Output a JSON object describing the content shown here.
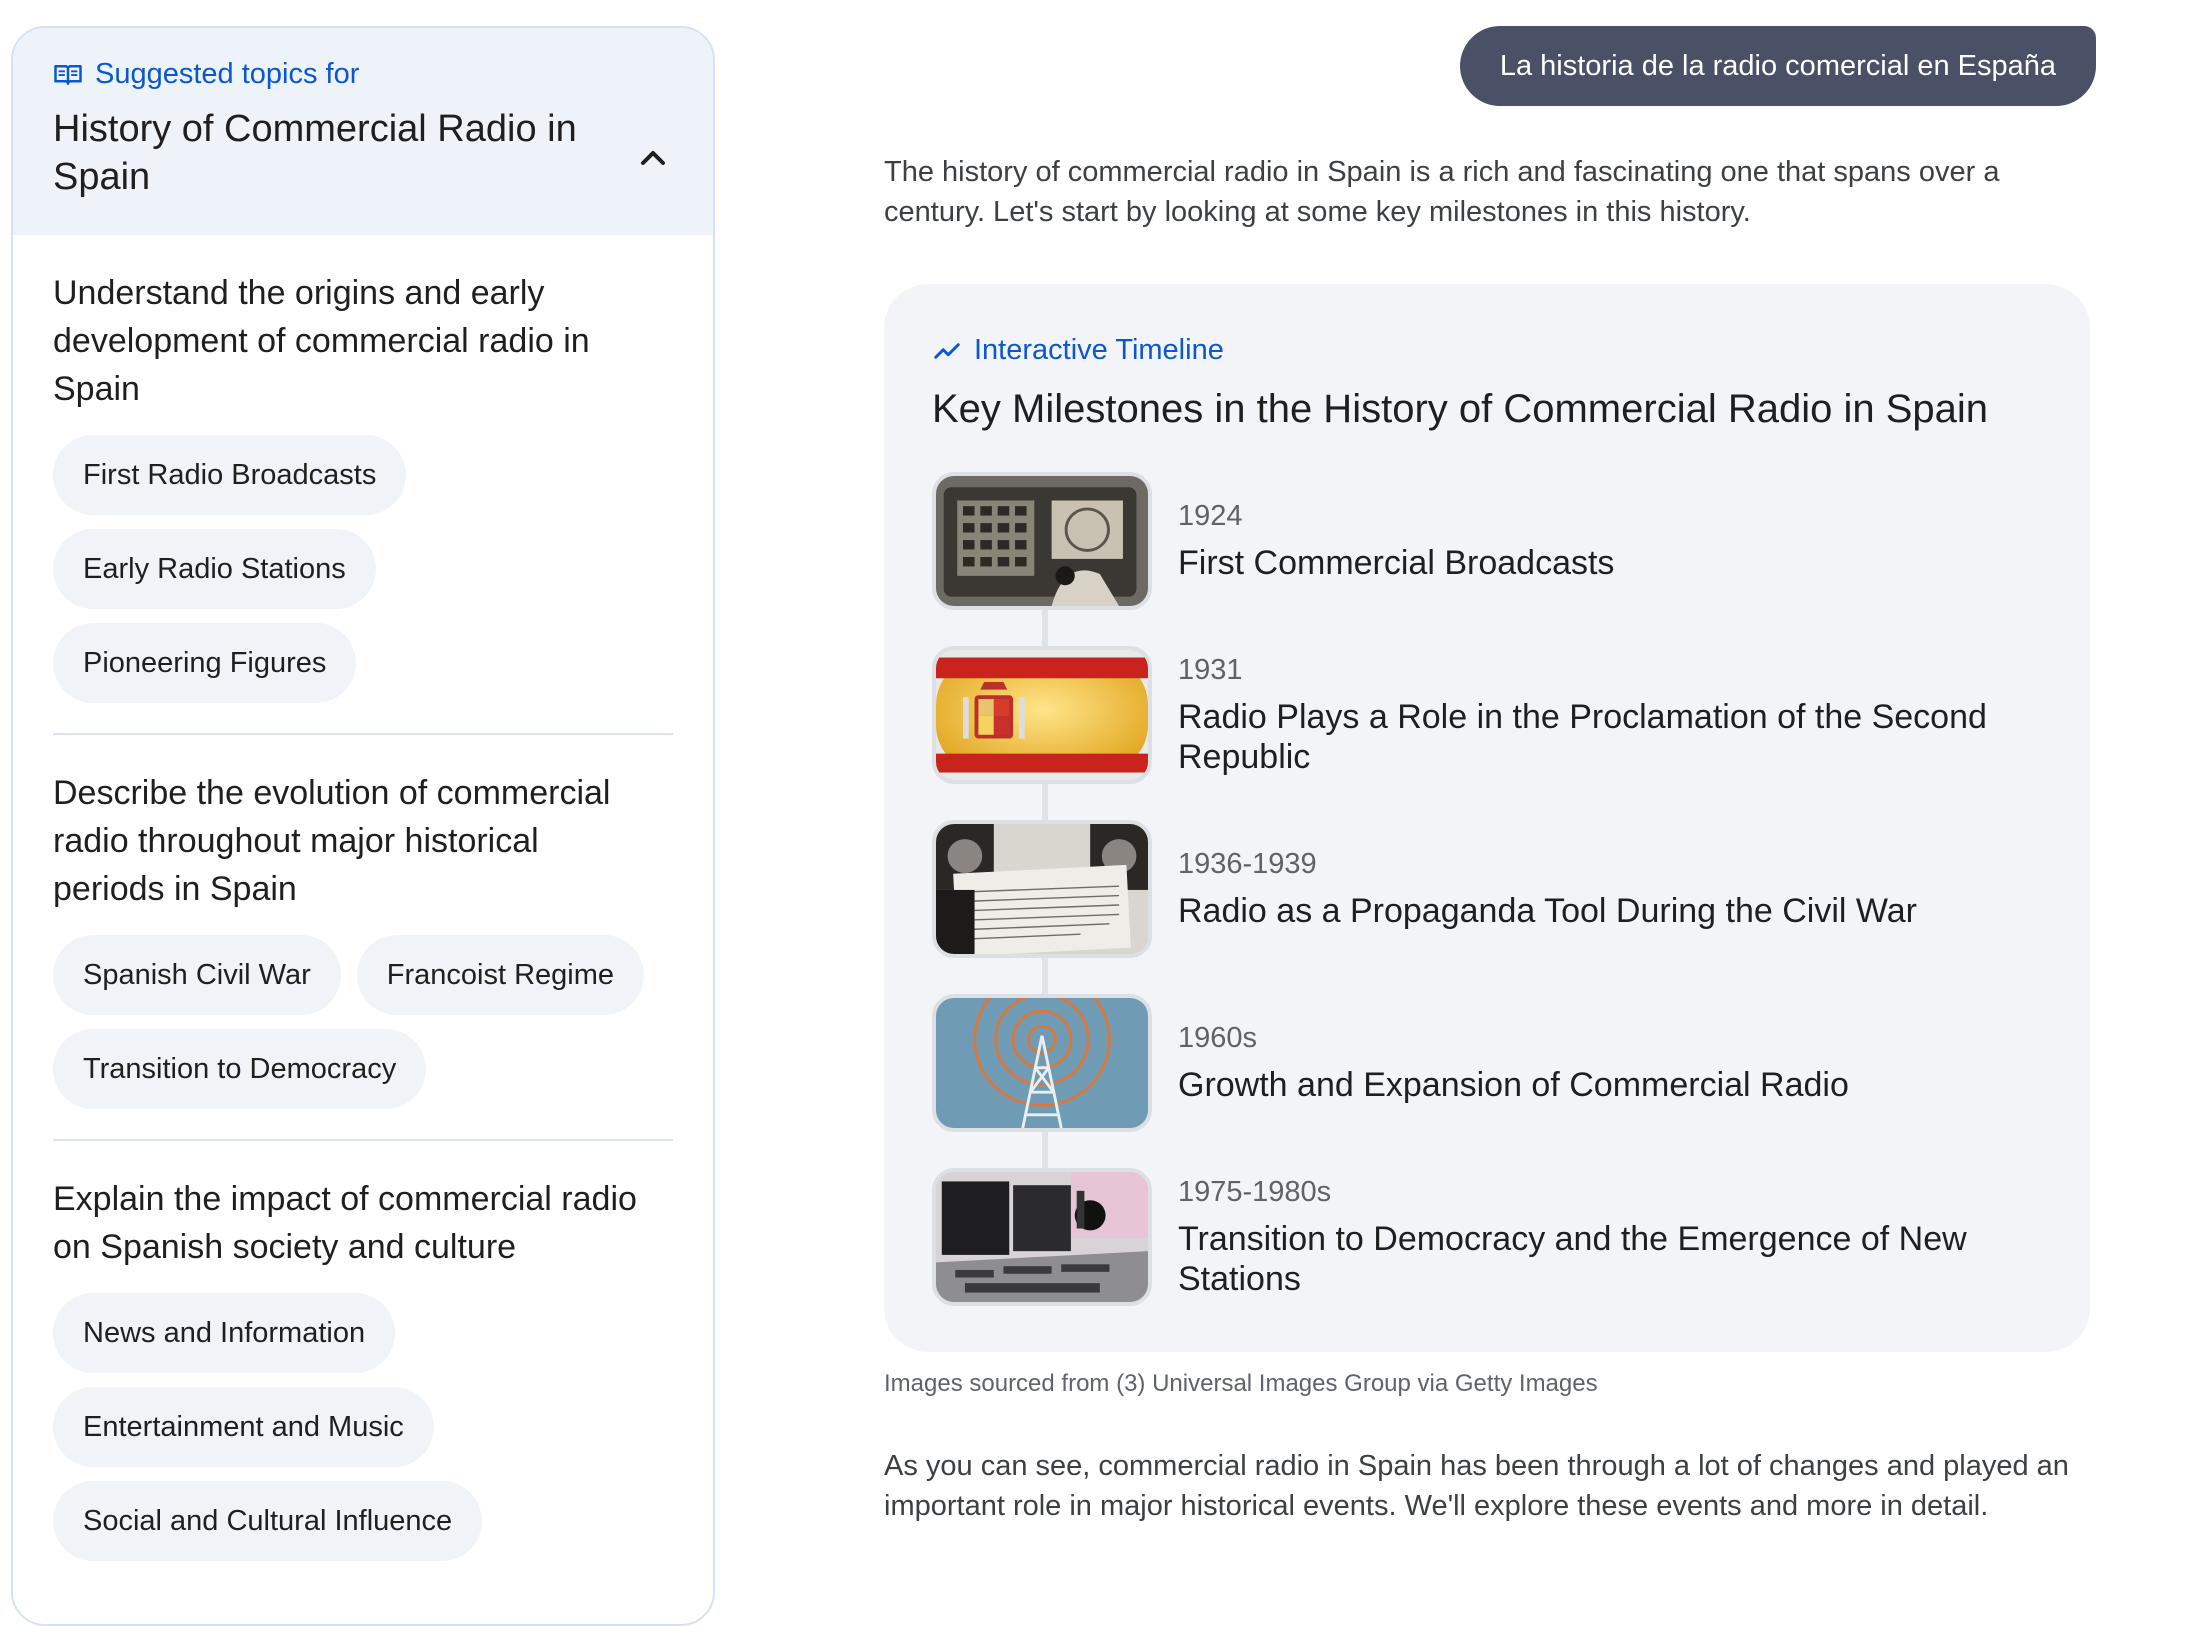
{
  "sidebar": {
    "kicker": "Suggested topics for",
    "title": "History of Commercial Radio in Spain",
    "sections": [
      {
        "heading": "Understand the origins and early development of commercial radio in Spain",
        "chips": [
          "First Radio Broadcasts",
          "Early Radio Stations",
          "Pioneering Figures"
        ]
      },
      {
        "heading": "Describe the evolution of commercial radio throughout major historical periods in Spain",
        "chips": [
          "Spanish Civil War",
          "Francoist Regime",
          "Transition to Democracy"
        ]
      },
      {
        "heading": "Explain the impact of commercial radio on Spanish society and culture",
        "chips": [
          "News and Information",
          "Entertainment and Music",
          "Social and Cultural Influence"
        ]
      }
    ]
  },
  "user_message": "La historia de la radio comercial en España",
  "intro": "The history of commercial radio in Spain is a rich and fascinating one that spans over a century. Let's start by looking at some key milestones in this history.",
  "timeline": {
    "kicker": "Interactive Timeline",
    "title": "Key Milestones in the History of Commercial Radio in Spain",
    "items": [
      {
        "date": "1924",
        "label": "First Commercial Broadcasts"
      },
      {
        "date": "1931",
        "label": "Radio Plays a Role in the Proclamation of the Second Republic"
      },
      {
        "date": "1936-1939",
        "label": "Radio as a Propaganda Tool During the Civil War"
      },
      {
        "date": "1960s",
        "label": "Growth and Expansion of Commercial Radio"
      },
      {
        "date": "1975-1980s",
        "label": "Transition to Democracy and the Emergence of New Stations"
      }
    ]
  },
  "source_note": "Images sourced from (3) Universal Images Group via Getty Images",
  "outro": "As you can see, commercial radio in Spain has been through a lot of changes and played an important role in major historical events. We'll explore these events and more in detail.",
  "colors": {
    "accent": "#0b57d0",
    "bubble": "#4a5166",
    "card": "#f2f4f7"
  }
}
